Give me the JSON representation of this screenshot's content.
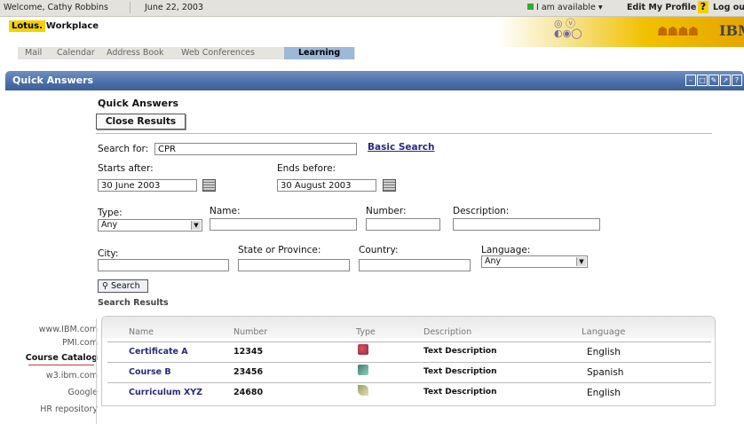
{
  "topbar": {
    "welcome": "Welcome, Cathy Robbins",
    "date": "June 22, 2003",
    "status": "I am available ▾",
    "edit_profile": "Edit My Profile",
    "help": "?",
    "logout": "Log ou"
  },
  "brand": {
    "lotus": "Lotus.",
    "workplace": "Workplace",
    "ibm": "IBM"
  },
  "tabs": [
    "Mail",
    "Calendar",
    "Address Book",
    "Web Conferences",
    "Learning"
  ],
  "portlet": {
    "title": "Quick Answers",
    "controls": [
      "–",
      "□",
      "✎",
      "↗",
      "?"
    ]
  },
  "left_nav": [
    "www.IBM.com",
    "PMI.com",
    "Course Catalog",
    "w3.ibm.com",
    "Google",
    "HR repository"
  ],
  "form": {
    "heading": "Quick Answers",
    "close_results": "Close Results",
    "search_for_label": "Search for:",
    "search_for_value": "CPR",
    "basic_search": "Basic Search",
    "starts_after_label": "Starts after:",
    "starts_after_value": "30 June 2003",
    "ends_before_label": "Ends before:",
    "ends_before_value": "30 August 2003",
    "type_label": "Type:",
    "type_value": "Any",
    "name_label": "Name:",
    "number_label": "Number:",
    "description_label": "Description:",
    "city_label": "City:",
    "state_label": "State or Province:",
    "country_label": "Country:",
    "language_label": "Language:",
    "language_value": "Any",
    "search_button": "Search"
  },
  "results": {
    "title": "Search Results",
    "columns": [
      "Name",
      "Number",
      "Type",
      "Description",
      "Language"
    ],
    "rows": [
      {
        "name": "Certificate A",
        "number": "12345",
        "type_icon": "certificate-icon",
        "description": "Text Description",
        "language": "English"
      },
      {
        "name": "Course B",
        "number": "23456",
        "type_icon": "course-icon",
        "description": "Text Description",
        "language": "Spanish"
      },
      {
        "name": "Curriculum XYZ",
        "number": "24680",
        "type_icon": "curriculum-icon",
        "description": "Text Description",
        "language": "English"
      }
    ]
  },
  "colors": {
    "portlet_header": "#4a6ea8",
    "active_tab": "#9eb8d8",
    "brand_yellow": "#f4d100",
    "link": "#2a2a7a"
  }
}
